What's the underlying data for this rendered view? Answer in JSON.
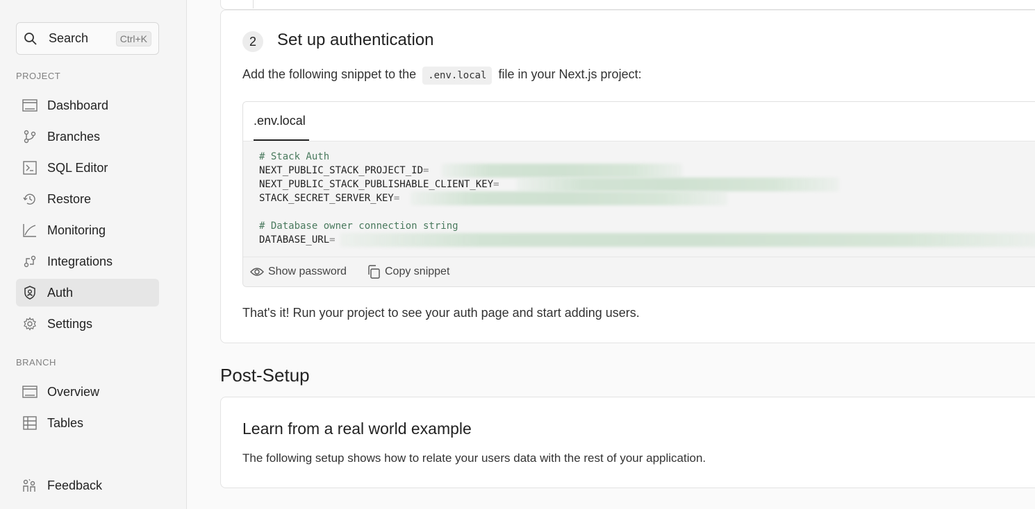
{
  "sidebar": {
    "search": {
      "label": "Search",
      "shortcut": "Ctrl+K"
    },
    "project_label": "PROJECT",
    "project_items": [
      {
        "label": "Dashboard",
        "icon": "dashboard-icon"
      },
      {
        "label": "Branches",
        "icon": "branch-icon"
      },
      {
        "label": "SQL Editor",
        "icon": "sql-editor-icon"
      },
      {
        "label": "Restore",
        "icon": "restore-icon"
      },
      {
        "label": "Monitoring",
        "icon": "monitoring-icon"
      },
      {
        "label": "Integrations",
        "icon": "integrations-icon"
      },
      {
        "label": "Auth",
        "icon": "auth-shield-icon",
        "active": true
      },
      {
        "label": "Settings",
        "icon": "gear-icon"
      }
    ],
    "branch_label": "BRANCH",
    "branch_items": [
      {
        "label": "Overview",
        "icon": "overview-icon"
      },
      {
        "label": "Tables",
        "icon": "table-icon"
      }
    ],
    "feedback": {
      "label": "Feedback",
      "icon": "feedback-icon"
    }
  },
  "step": {
    "number": "2",
    "title": "Set up authentication",
    "intro_before": "Add the following snippet to the",
    "intro_code": ".env.local",
    "intro_after": "file in your Next.js project:",
    "code": {
      "tab": ".env.local",
      "comment1": "# Stack Auth",
      "key1": "NEXT_PUBLIC_STACK_PROJECT_ID",
      "key2": "NEXT_PUBLIC_STACK_PUBLISHABLE_CLIENT_KEY",
      "key3": "STACK_SECRET_SERVER_KEY",
      "comment2": "# Database owner connection string",
      "key4": "DATABASE_URL",
      "eq": "="
    },
    "show_password": "Show password",
    "copy_snippet": "Copy snippet",
    "outro": "That's it! Run your project to see your auth page and start adding users."
  },
  "post_setup": {
    "title": "Post-Setup",
    "example_title": "Learn from a real world example",
    "example_text": "The following setup shows how to relate your users data with the rest of your application."
  }
}
